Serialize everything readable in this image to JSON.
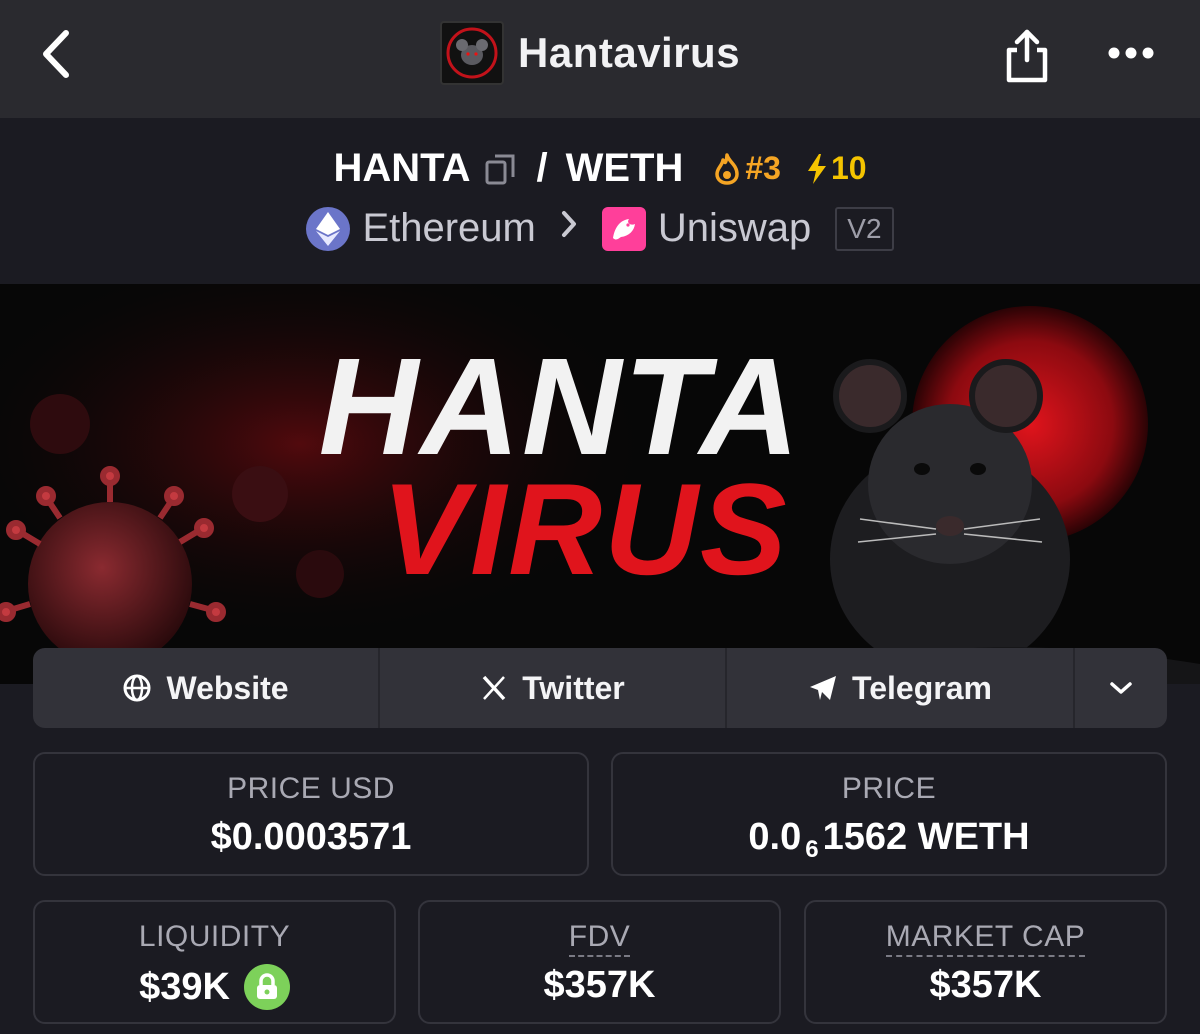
{
  "nav": {
    "title": "Hantavirus",
    "back_icon": "chevron-left-icon",
    "share_icon": "share-icon",
    "more_icon": "more-horizontal-icon"
  },
  "pair": {
    "base": "HANTA",
    "separator": "/",
    "quote": "WETH",
    "rank": "#3",
    "boosts": "10",
    "chain": "Ethereum",
    "dex": "Uniswap",
    "dex_version": "V2"
  },
  "banner": {
    "line1": "HANTA",
    "line2": "VIRUS"
  },
  "socials": {
    "website": "Website",
    "twitter": "Twitter",
    "telegram": "Telegram"
  },
  "stats": {
    "price_usd_label": "PRICE USD",
    "price_usd_value": "$0.0003571",
    "price_label": "PRICE",
    "price_prefix": "0.0",
    "price_subscript": "6",
    "price_suffix": "1562 WETH",
    "liquidity_label": "LIQUIDITY",
    "liquidity_value": "$39K",
    "fdv_label": "FDV",
    "fdv_value": "$357K",
    "mcap_label": "MARKET CAP",
    "mcap_value": "$357K"
  },
  "colors": {
    "background": "#1b1b22",
    "topbar": "#2a2a2f",
    "rank": "#f5a524",
    "boost": "#f5c400",
    "lock": "#7dd15a",
    "uniswap": "#ff3f9a",
    "ethereum": "#6b75c9",
    "banner_red": "#e0141c"
  }
}
